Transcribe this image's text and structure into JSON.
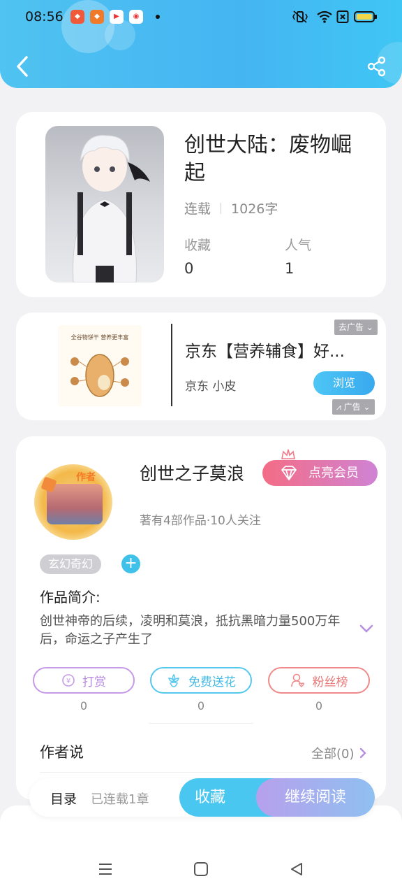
{
  "status_bar": {
    "time": "08:56",
    "app_icons": [
      "app-icon-1",
      "app-icon-2",
      "app-icon-3",
      "weibo-icon"
    ],
    "system_icons": [
      "vibrate-icon",
      "wifi-icon",
      "sim-off-icon",
      "battery-icon"
    ]
  },
  "header": {
    "back_icon": "chevron-left-icon",
    "share_icon": "share-icon",
    "color": "#4fc3f1"
  },
  "book": {
    "title": "创世大陆：废物崛起",
    "status": "连载",
    "word_count": "1026字",
    "favorites_label": "收藏",
    "favorites_value": "0",
    "popularity_label": "人气",
    "popularity_value": "1"
  },
  "ad": {
    "image_caption": "全谷物饼干 营养更丰富",
    "title": "京东【营养辅食】好...",
    "source": "京东 小皮",
    "browse_label": "浏览",
    "remove_ad_label": "去广告",
    "ad_label": "广告"
  },
  "author": {
    "badge": "作者",
    "name": "创世之子莫浪",
    "vip_label": "点亮会员",
    "info": "著有4部作品·10人关注",
    "genre_tag": "玄幻奇幻",
    "add_tag_label": "+",
    "intro_label": "作品简介:",
    "intro_text": "创世神帝的后续，凌明和莫浪，抵抗黑暗力量500万年后，命运之子产生了",
    "actions": [
      {
        "label": "打赏",
        "count": "0",
        "icon": "yen-coin-icon",
        "color": "#c79ae6"
      },
      {
        "label": "免费送花",
        "count": "0",
        "icon": "flower-icon",
        "color": "#56c8ee"
      },
      {
        "label": "粉丝榜",
        "count": "0",
        "icon": "fan-user-icon",
        "color": "#ee8a8a"
      }
    ],
    "author_says_label": "作者说",
    "author_says_all": "全部(0)"
  },
  "bottom_bar": {
    "toc_label": "目录",
    "serial_info": "已连载1章",
    "favorite_label": "收藏",
    "read_label": "继续阅读"
  },
  "nav": {
    "icons": [
      "menu-icon",
      "home-square-icon",
      "back-triangle-icon"
    ]
  }
}
